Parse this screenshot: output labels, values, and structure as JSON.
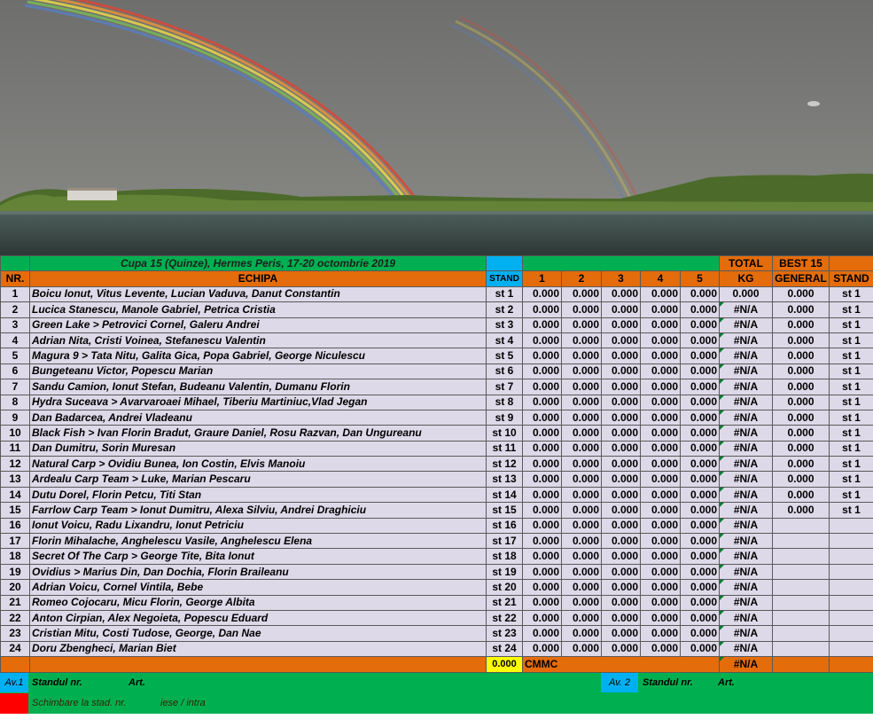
{
  "header": {
    "title": "Cupa 15 (Quinze), Hermes Peris, 17-20 octombrie 2019",
    "col_nr": "NR.",
    "col_echipa": "ECHIPA",
    "col_stand": "STAND",
    "col_1": "1",
    "col_2": "2",
    "col_3": "3",
    "col_4": "4",
    "col_5": "5",
    "total_top": "TOTAL",
    "total_bottom": "KG",
    "best_top": "BEST 15",
    "best_bottom": "GENERAL",
    "stand_last": "STAND"
  },
  "rows": [
    {
      "nr": "1",
      "echipa": "Boicu Ionut, Vitus Levente, Lucian Vaduva, Danut Constantin",
      "stand": "st 1",
      "v1": "0.000",
      "v2": "0.000",
      "v3": "0.000",
      "v4": "0.000",
      "v5": "0.000",
      "total": "0.000",
      "best": "0.000",
      "stand2": "st 1"
    },
    {
      "nr": "2",
      "echipa": "Lucica Stanescu, Manole Gabriel, Petrica Cristia",
      "stand": "st 2",
      "v1": "0.000",
      "v2": "0.000",
      "v3": "0.000",
      "v4": "0.000",
      "v5": "0.000",
      "total": "#N/A",
      "best": "0.000",
      "stand2": "st 1"
    },
    {
      "nr": "3",
      "echipa": "Green Lake > Petrovici Cornel, Galeru Andrei",
      "stand": "st 3",
      "v1": "0.000",
      "v2": "0.000",
      "v3": "0.000",
      "v4": "0.000",
      "v5": "0.000",
      "total": "#N/A",
      "best": "0.000",
      "stand2": "st 1"
    },
    {
      "nr": "4",
      "echipa": "Adrian Nita, Cristi Voinea, Stefanescu Valentin",
      "stand": "st 4",
      "v1": "0.000",
      "v2": "0.000",
      "v3": "0.000",
      "v4": "0.000",
      "v5": "0.000",
      "total": "#N/A",
      "best": "0.000",
      "stand2": "st 1"
    },
    {
      "nr": "5",
      "echipa": "Magura 9  > Tata Nitu, Galita Gica, Popa Gabriel, George Niculescu",
      "stand": "st 5",
      "v1": "0.000",
      "v2": "0.000",
      "v3": "0.000",
      "v4": "0.000",
      "v5": "0.000",
      "total": "#N/A",
      "best": "0.000",
      "stand2": "st 1"
    },
    {
      "nr": "6",
      "echipa": "Bungeteanu Victor, Popescu Marian",
      "stand": "st 6",
      "v1": "0.000",
      "v2": "0.000",
      "v3": "0.000",
      "v4": "0.000",
      "v5": "0.000",
      "total": "#N/A",
      "best": "0.000",
      "stand2": "st 1"
    },
    {
      "nr": "7",
      "echipa": "Sandu Camion, Ionut Stefan, Budeanu Valentin, Dumanu Florin",
      "stand": "st 7",
      "v1": "0.000",
      "v2": "0.000",
      "v3": "0.000",
      "v4": "0.000",
      "v5": "0.000",
      "total": "#N/A",
      "best": "0.000",
      "stand2": "st 1"
    },
    {
      "nr": "8",
      "echipa": "Hydra Suceava > Avarvaroaei Mihael, Tiberiu Martiniuc,Vlad Jegan",
      "stand": "st 8",
      "v1": "0.000",
      "v2": "0.000",
      "v3": "0.000",
      "v4": "0.000",
      "v5": "0.000",
      "total": "#N/A",
      "best": "0.000",
      "stand2": "st 1"
    },
    {
      "nr": "9",
      "echipa": "Dan Badarcea, Andrei Vladeanu",
      "stand": "st 9",
      "v1": "0.000",
      "v2": "0.000",
      "v3": "0.000",
      "v4": "0.000",
      "v5": "0.000",
      "total": "#N/A",
      "best": "0.000",
      "stand2": "st 1"
    },
    {
      "nr": "10",
      "echipa": "Black Fish > Ivan Florin Bradut, Graure Daniel, Rosu Razvan, Dan Ungureanu",
      "stand": "st 10",
      "v1": "0.000",
      "v2": "0.000",
      "v3": "0.000",
      "v4": "0.000",
      "v5": "0.000",
      "total": "#N/A",
      "best": "0.000",
      "stand2": "st 1"
    },
    {
      "nr": "11",
      "echipa": "Dan Dumitru, Sorin Muresan",
      "stand": "st 11",
      "v1": "0.000",
      "v2": "0.000",
      "v3": "0.000",
      "v4": "0.000",
      "v5": "0.000",
      "total": "#N/A",
      "best": "0.000",
      "stand2": "st 1"
    },
    {
      "nr": "12",
      "echipa": "Natural Carp > Ovidiu Bunea, Ion Costin, Elvis Manoiu",
      "stand": "st 12",
      "v1": "0.000",
      "v2": "0.000",
      "v3": "0.000",
      "v4": "0.000",
      "v5": "0.000",
      "total": "#N/A",
      "best": "0.000",
      "stand2": "st 1"
    },
    {
      "nr": "13",
      "echipa": "Ardealu Carp Team  > Luke, Marian Pescaru",
      "stand": "st 13",
      "v1": "0.000",
      "v2": "0.000",
      "v3": "0.000",
      "v4": "0.000",
      "v5": "0.000",
      "total": "#N/A",
      "best": "0.000",
      "stand2": "st 1"
    },
    {
      "nr": "14",
      "echipa": "Dutu Dorel, Florin Petcu, Titi Stan",
      "stand": "st 14",
      "v1": "0.000",
      "v2": "0.000",
      "v3": "0.000",
      "v4": "0.000",
      "v5": "0.000",
      "total": "#N/A",
      "best": "0.000",
      "stand2": "st 1"
    },
    {
      "nr": "15",
      "echipa": "Farrlow Carp Team > Ionut Dumitru, Alexa Silviu, Andrei Draghiciu",
      "stand": "st 15",
      "v1": "0.000",
      "v2": "0.000",
      "v3": "0.000",
      "v4": "0.000",
      "v5": "0.000",
      "total": "#N/A",
      "best": "0.000",
      "stand2": "st 1"
    },
    {
      "nr": "16",
      "echipa": "Ionut Voicu, Radu Lixandru, Ionut Petriciu",
      "stand": "st 16",
      "v1": "0.000",
      "v2": "0.000",
      "v3": "0.000",
      "v4": "0.000",
      "v5": "0.000",
      "total": "#N/A",
      "best": "",
      "stand2": ""
    },
    {
      "nr": "17",
      "echipa": "Florin Mihalache, Anghelescu Vasile, Anghelescu Elena",
      "stand": "st 17",
      "v1": "0.000",
      "v2": "0.000",
      "v3": "0.000",
      "v4": "0.000",
      "v5": "0.000",
      "total": "#N/A",
      "best": "",
      "stand2": ""
    },
    {
      "nr": "18",
      "echipa": "Secret Of The Carp >  George Tite, Bita Ionut",
      "stand": "st 18",
      "v1": "0.000",
      "v2": "0.000",
      "v3": "0.000",
      "v4": "0.000",
      "v5": "0.000",
      "total": "#N/A",
      "best": "",
      "stand2": ""
    },
    {
      "nr": "19",
      "echipa": "Ovidius > Marius Din, Dan Dochia, Florin Braileanu",
      "stand": "st 19",
      "v1": "0.000",
      "v2": "0.000",
      "v3": "0.000",
      "v4": "0.000",
      "v5": "0.000",
      "total": "#N/A",
      "best": "",
      "stand2": ""
    },
    {
      "nr": "20",
      "echipa": "Adrian Voicu, Cornel Vintila, Bebe",
      "stand": "st 20",
      "v1": "0.000",
      "v2": "0.000",
      "v3": "0.000",
      "v4": "0.000",
      "v5": "0.000",
      "total": "#N/A",
      "best": "",
      "stand2": ""
    },
    {
      "nr": "21",
      "echipa": "Romeo Cojocaru, Micu Florin, George Albita",
      "stand": "st 21",
      "v1": "0.000",
      "v2": "0.000",
      "v3": "0.000",
      "v4": "0.000",
      "v5": "0.000",
      "total": "#N/A",
      "best": "",
      "stand2": ""
    },
    {
      "nr": "22",
      "echipa": "Anton Cirpian, Alex Negoieta, Popescu Eduard",
      "stand": "st 22",
      "v1": "0.000",
      "v2": "0.000",
      "v3": "0.000",
      "v4": "0.000",
      "v5": "0.000",
      "total": "#N/A",
      "best": "",
      "stand2": ""
    },
    {
      "nr": "23",
      "echipa": "Cristian Mitu, Costi Tudose, George, Dan Nae",
      "stand": "st 23",
      "v1": "0.000",
      "v2": "0.000",
      "v3": "0.000",
      "v4": "0.000",
      "v5": "0.000",
      "total": "#N/A",
      "best": "",
      "stand2": ""
    },
    {
      "nr": "24",
      "echipa": "Doru Zbengheci, Marian Biet",
      "stand": "st 24",
      "v1": "0.000",
      "v2": "0.000",
      "v3": "0.000",
      "v4": "0.000",
      "v5": "0.000",
      "total": "#N/A",
      "best": "",
      "stand2": ""
    }
  ],
  "summary": {
    "sum_value": "0.000",
    "cmmc_label": "CMMC",
    "cmmc_value": "#N/A"
  },
  "footer": {
    "av1_label": "Av.1",
    "av1_standul": "Standul nr.",
    "av1_art": "Art.",
    "av2_label": "Av. 2",
    "av2_standul": "Standul  nr.",
    "av2_art": "Art.",
    "schimbare": "Schimbare la stad.  nr.",
    "iese": "iese / intra"
  },
  "colors": {
    "green": "#00b050",
    "orange": "#e46c0a",
    "cyan": "#00b0f0",
    "row_bg": "#ddd9e8",
    "yellow": "#ffff00",
    "red": "#ff0000"
  }
}
